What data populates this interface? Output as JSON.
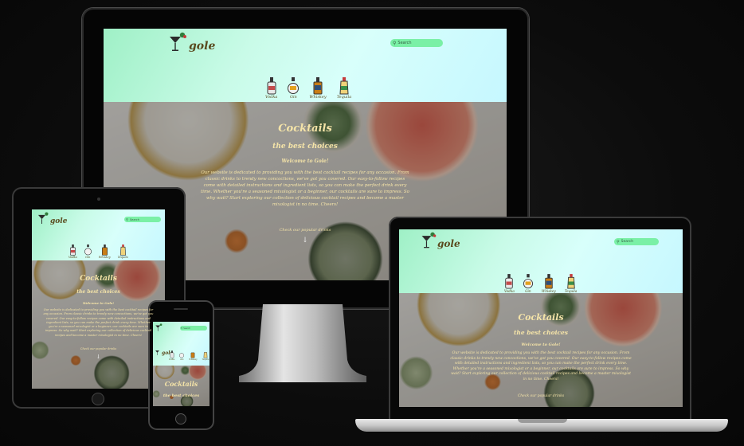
{
  "site": {
    "logo_text": "gole",
    "search_placeholder": "Search",
    "categories": [
      {
        "label": "Vodka",
        "icon": "vodka-bottle-icon",
        "color": "#c44b4b"
      },
      {
        "label": "Gin",
        "icon": "gin-bottle-icon",
        "color": "#2e6a8c"
      },
      {
        "label": "Whiskey",
        "icon": "whiskey-bottle-icon",
        "color": "#c97d16"
      },
      {
        "label": "Tequila",
        "icon": "tequila-bottle-icon",
        "color": "#d6a423"
      }
    ],
    "hero": {
      "title": "Cocktails",
      "subtitle": "the best choices",
      "welcome": "Welcome to Gole!",
      "body": "Our website is dedicated to providing you with the best cocktail recipes for any occasion. From classic drinks to trendy new concoctions, we've got you covered. Our easy-to-follow recipes come with detailed instructions and ingredient lists, so you can make the perfect drink every time. Whether you're a seasoned mixologist or a beginner, our cocktails are sure to impress. So why wait? Start exploring our collection of delicious cocktail recipes and become a master mixologist in no time. Cheers!",
      "cta": "Check our popular drinks",
      "cta_icon": "arrow-down-icon"
    }
  },
  "colors": {
    "header_gradient_start": "#9ff0c6",
    "header_gradient_end": "#c6f7ff",
    "search_bg": "#7af0a6",
    "hero_text": "#f5e4a8",
    "logo_text": "#5a4a1e",
    "background": "#0c0c0c"
  }
}
